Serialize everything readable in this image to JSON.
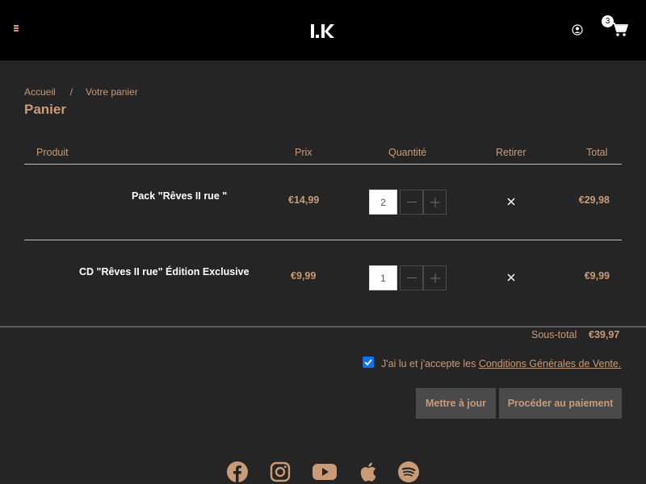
{
  "header": {
    "logo_alt": "I.K",
    "cart_count": "3",
    "menu_icon": "hamburger-menu-icon",
    "account_icon": "user-account-icon",
    "cart_icon": "shopping-cart-icon"
  },
  "breadcrumb": {
    "home": "Accueil",
    "separator": "/",
    "current": "Votre panier"
  },
  "page_title": "Panier",
  "table": {
    "headers": [
      "Produit",
      "Prix",
      "Quantité",
      "Retirer",
      "Total"
    ],
    "rows": [
      {
        "product": "Pack \"Rêves II rue \"",
        "price": "€14,99",
        "quantity": "2",
        "total": "€29,98"
      },
      {
        "product": "CD \"Rêves II rue\" Édition Exclusive",
        "price": "€9,99",
        "quantity": "1",
        "total": "€9,99"
      }
    ]
  },
  "summary": {
    "subtotal_label": "Sous-total",
    "subtotal_value": "€39,97"
  },
  "terms": {
    "text": "J'ai lu et j'accepte les ",
    "link": "Conditions Générales de Vente.",
    "checked": true
  },
  "actions": {
    "update": "Mettre à jour",
    "checkout": "Procéder au paiement"
  },
  "social": [
    "facebook-icon",
    "instagram-icon",
    "youtube-icon",
    "apple-music-icon",
    "spotify-icon"
  ],
  "colors": {
    "background": "#252525",
    "header": "#000000",
    "accent": "#c99b77",
    "button": "#4a4a4a",
    "checkbox": "#0075ff"
  }
}
